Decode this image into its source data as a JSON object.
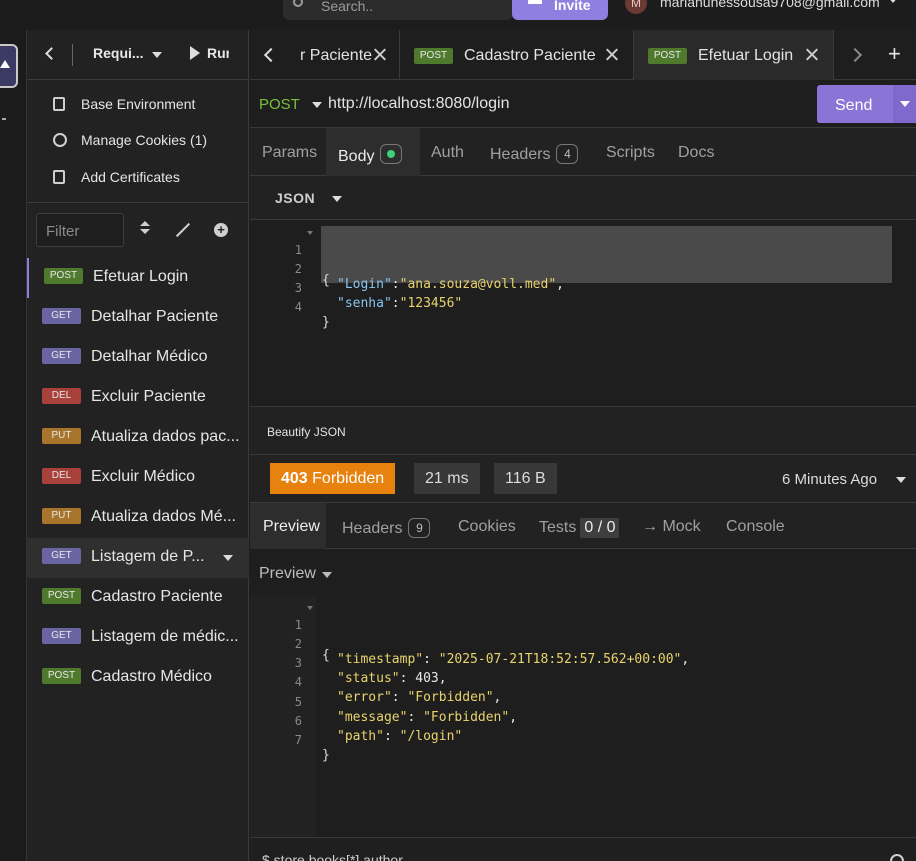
{
  "topbar": {
    "search_placeholder": "Search..",
    "invite_label": "Invite",
    "avatar_initial": "M",
    "user_email": "marianunessousa9708@gmail.com"
  },
  "sidebar": {
    "title": "Requi...",
    "run_label": "Run",
    "links": [
      "Base Environment",
      "Manage Cookies (1)",
      "Add Certificates"
    ],
    "filter_placeholder": "Filter",
    "requests": [
      {
        "method": "POST",
        "name": "Efetuar Login"
      },
      {
        "method": "GET",
        "name": "Detalhar Paciente"
      },
      {
        "method": "GET",
        "name": "Detalhar Médico"
      },
      {
        "method": "DEL",
        "name": "Excluir Paciente"
      },
      {
        "method": "PUT",
        "name": "Atualiza dados pac..."
      },
      {
        "method": "DEL",
        "name": "Excluir Médico"
      },
      {
        "method": "PUT",
        "name": "Atualiza dados Mé..."
      },
      {
        "method": "GET",
        "name": "Listagem de P..."
      },
      {
        "method": "POST",
        "name": "Cadastro Paciente"
      },
      {
        "method": "GET",
        "name": "Listagem de médic..."
      },
      {
        "method": "POST",
        "name": "Cadastro Médico"
      }
    ]
  },
  "tabs": [
    {
      "method": "",
      "name": "r Paciente"
    },
    {
      "method": "POST",
      "name": "Cadastro Paciente"
    },
    {
      "method": "POST",
      "name": "Efetuar Login"
    }
  ],
  "request": {
    "method": "POST",
    "url": "http://localhost:8080/login",
    "send_label": "Send",
    "tabs": {
      "params": "Params",
      "body": "Body",
      "auth": "Auth",
      "headers": "Headers",
      "headers_count": "4",
      "scripts": "Scripts",
      "docs": "Docs"
    },
    "body_type": "JSON",
    "beautify_label": "Beautify JSON",
    "body_lines": [
      {
        "n": "1",
        "open": "{"
      },
      {
        "n": "2",
        "key": "\"Login\"",
        "sep": ":",
        "val": "\"ana.souza@voll.med\"",
        "end": ","
      },
      {
        "n": "3",
        "key": "\"senha\"",
        "sep": ":",
        "val": "\"123456\"",
        "end": ""
      },
      {
        "n": "4",
        "open": "}"
      }
    ]
  },
  "response": {
    "status_code": "403",
    "status_text": "Forbidden",
    "time": "21 ms",
    "size": "116 B",
    "ago": "6 Minutes Ago",
    "tabs": {
      "preview": "Preview",
      "headers": "Headers",
      "headers_count": "9",
      "cookies": "Cookies",
      "tests": "Tests",
      "tests_count": "0 / 0",
      "mock": "→ Mock",
      "console": "Console"
    },
    "preview_mode": "Preview",
    "lines": [
      {
        "n": "1",
        "open": "{"
      },
      {
        "n": "2",
        "key": "\"timestamp\"",
        "sep": ": ",
        "val": "\"2025-07-21T18:52:57.562+00:00\"",
        "end": ","
      },
      {
        "n": "3",
        "key": "\"status\"",
        "sep": ": ",
        "num": "403",
        "end": ","
      },
      {
        "n": "4",
        "key": "\"error\"",
        "sep": ": ",
        "val": "\"Forbidden\"",
        "end": ","
      },
      {
        "n": "5",
        "key": "\"message\"",
        "sep": ": ",
        "val": "\"Forbidden\"",
        "end": ","
      },
      {
        "n": "6",
        "key": "\"path\"",
        "sep": ": ",
        "val": "\"/login\"",
        "end": ""
      },
      {
        "n": "7",
        "open": "}"
      }
    ]
  },
  "footer": {
    "filter_text": "$.store.books[*].author"
  }
}
